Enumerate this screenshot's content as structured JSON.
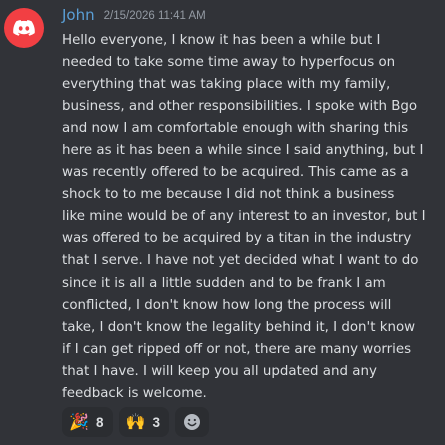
{
  "message": {
    "author": "John",
    "timestamp": "2/15/2026 11:41 AM",
    "avatar_icon": "discord-logo-icon",
    "lines": [
      "Hello everyone, I know it has been a while but I",
      "needed to take some time away to hyperfocus on",
      "everything that was taking place with my family,",
      "business, and other responsibilities. I spoke with Bgo",
      "and now I am comfortable enough with sharing this",
      "here as it has been a while since I said anything, but I",
      "was recently offered to be acquired.  This came as a",
      "shock to to me because I did not think a business",
      "like mine would be of any interest to an investor, but I",
      "was offered to be acquired by a titan in the industry",
      "that I serve. I have not yet decided what I want to do",
      "since it is all a little sudden and to be frank I am",
      "conflicted, I don't know how long the process will",
      "take, I don't know the legality behind it, I don't know",
      "if I can get ripped off or not, there are many worries",
      "that I have. I will keep you all updated and any",
      "feedback is welcome."
    ]
  },
  "reactions": [
    {
      "emoji": "🎉",
      "icon": "party-popper-icon",
      "count": "8"
    },
    {
      "emoji": "🙌",
      "icon": "raising-hands-icon",
      "count": "3"
    }
  ],
  "add_reaction_icon": "add-reaction-smiley-icon",
  "colors": {
    "background": "#313338",
    "username": "#5a9fd6",
    "avatar": "#f23f43",
    "text": "#dbdee1",
    "timestamp": "#949ba4",
    "reaction_bg": "#2b2d31"
  }
}
